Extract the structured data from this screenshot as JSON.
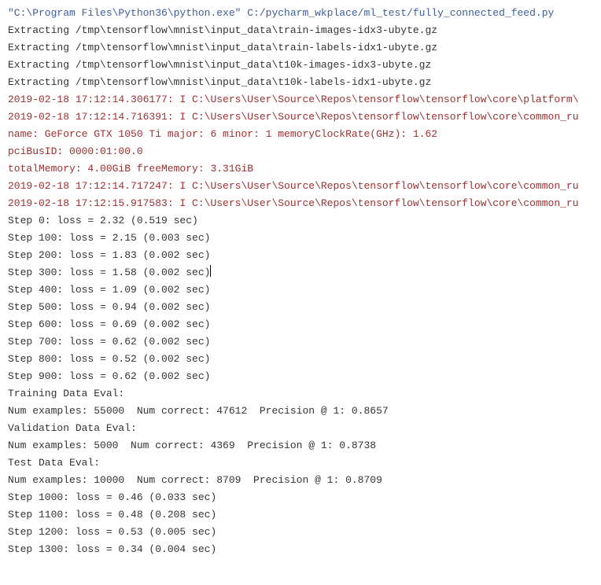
{
  "command": "\"C:\\Program Files\\Python36\\python.exe\" C:/pycharm_wkplace/ml_test/fully_connected_feed.py",
  "extracting": [
    "Extracting /tmp\\tensorflow\\mnist\\input_data\\train-images-idx3-ubyte.gz",
    "Extracting /tmp\\tensorflow\\mnist\\input_data\\train-labels-idx1-ubyte.gz",
    "Extracting /tmp\\tensorflow\\mnist\\input_data\\t10k-images-idx3-ubyte.gz",
    "Extracting /tmp\\tensorflow\\mnist\\input_data\\t10k-labels-idx1-ubyte.gz"
  ],
  "stderr": [
    "2019-02-18 17:12:14.306177: I C:\\Users\\User\\Source\\Repos\\tensorflow\\tensorflow\\core\\platform\\",
    "2019-02-18 17:12:14.716391: I C:\\Users\\User\\Source\\Repos\\tensorflow\\tensorflow\\core\\common_ru",
    "name: GeForce GTX 1050 Ti major: 6 minor: 1 memoryClockRate(GHz): 1.62",
    "pciBusID: 0000:01:00.0",
    "totalMemory: 4.00GiB freeMemory: 3.31GiB",
    "2019-02-18 17:12:14.717247: I C:\\Users\\User\\Source\\Repos\\tensorflow\\tensorflow\\core\\common_ru",
    "2019-02-18 17:12:15.917583: I C:\\Users\\User\\Source\\Repos\\tensorflow\\tensorflow\\core\\common_ru"
  ],
  "steps1": [
    "Step 0: loss = 2.32 (0.519 sec)",
    "Step 100: loss = 2.15 (0.003 sec)",
    "Step 200: loss = 1.83 (0.002 sec)"
  ],
  "step_caret": "Step 300: loss = 1.58 (0.002 sec)",
  "steps2": [
    "Step 400: loss = 1.09 (0.002 sec)",
    "Step 500: loss = 0.94 (0.002 sec)",
    "Step 600: loss = 0.69 (0.002 sec)",
    "Step 700: loss = 0.62 (0.002 sec)",
    "Step 800: loss = 0.52 (0.002 sec)",
    "Step 900: loss = 0.62 (0.002 sec)"
  ],
  "evals": [
    "Training Data Eval:",
    "Num examples: 55000  Num correct: 47612  Precision @ 1: 0.8657",
    "Validation Data Eval:",
    "Num examples: 5000  Num correct: 4369  Precision @ 1: 0.8738",
    "Test Data Eval:",
    "Num examples: 10000  Num correct: 8709  Precision @ 1: 0.8709"
  ],
  "steps3": [
    "Step 1000: loss = 0.46 (0.033 sec)",
    "Step 1100: loss = 0.48 (0.208 sec)",
    "Step 1200: loss = 0.53 (0.005 sec)",
    "Step 1300: loss = 0.34 (0.004 sec)"
  ]
}
